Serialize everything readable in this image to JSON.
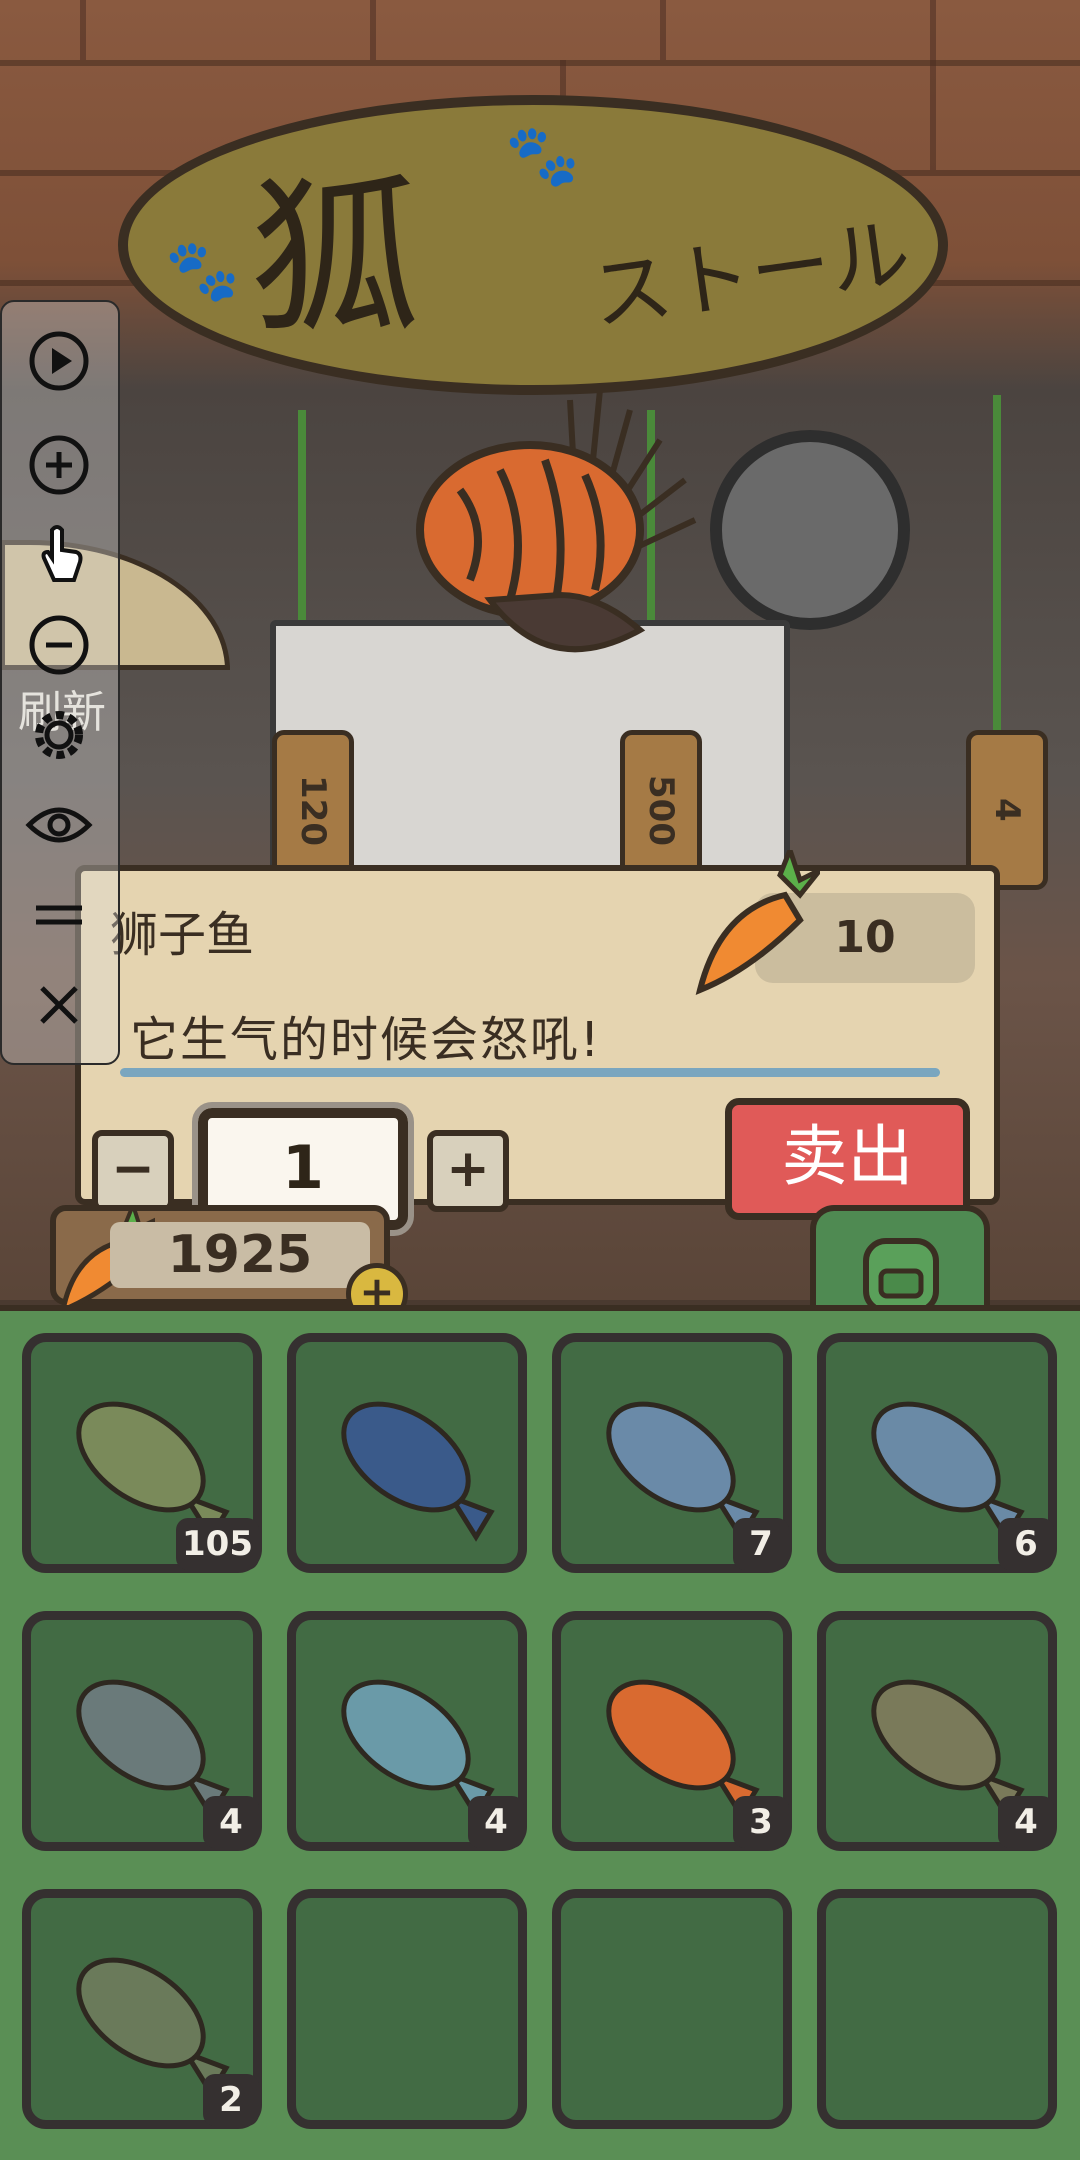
{
  "sign": {
    "main": "狐",
    "sub": "ストール"
  },
  "tags": [
    "120",
    "500",
    "4"
  ],
  "fan_label": "刷新",
  "item": {
    "name": "狮子鱼",
    "description": "它生气的时候会怒吼!",
    "price": "10"
  },
  "quantity": {
    "minus_label": "−",
    "value": "1",
    "plus_label": "+"
  },
  "sell_label": "卖出",
  "balance": {
    "value": "1925",
    "add_label": "+"
  },
  "inventory": [
    {
      "name": "catfish",
      "count": "105"
    },
    {
      "name": "marlin",
      "count": ""
    },
    {
      "name": "sardine",
      "count": "7"
    },
    {
      "name": "salmon",
      "count": "6"
    },
    {
      "name": "piranha",
      "count": "4"
    },
    {
      "name": "blue-fish",
      "count": "4"
    },
    {
      "name": "lionfish",
      "count": "3"
    },
    {
      "name": "carp",
      "count": "4"
    },
    {
      "name": "bass",
      "count": "2"
    },
    {
      "name": "empty",
      "count": ""
    },
    {
      "name": "empty",
      "count": ""
    },
    {
      "name": "empty",
      "count": ""
    }
  ],
  "toolbar": {
    "icons": [
      "play-icon",
      "zoom-in-icon",
      "hand-pointer-icon",
      "zoom-out-icon",
      "gear-icon",
      "eye-icon",
      "menu-icon",
      "close-icon"
    ]
  },
  "colors": {
    "sell": "#e05a58",
    "panel": "#e5d4b0",
    "inventory_bg": "#5a8f55",
    "slot": "#426b44"
  }
}
